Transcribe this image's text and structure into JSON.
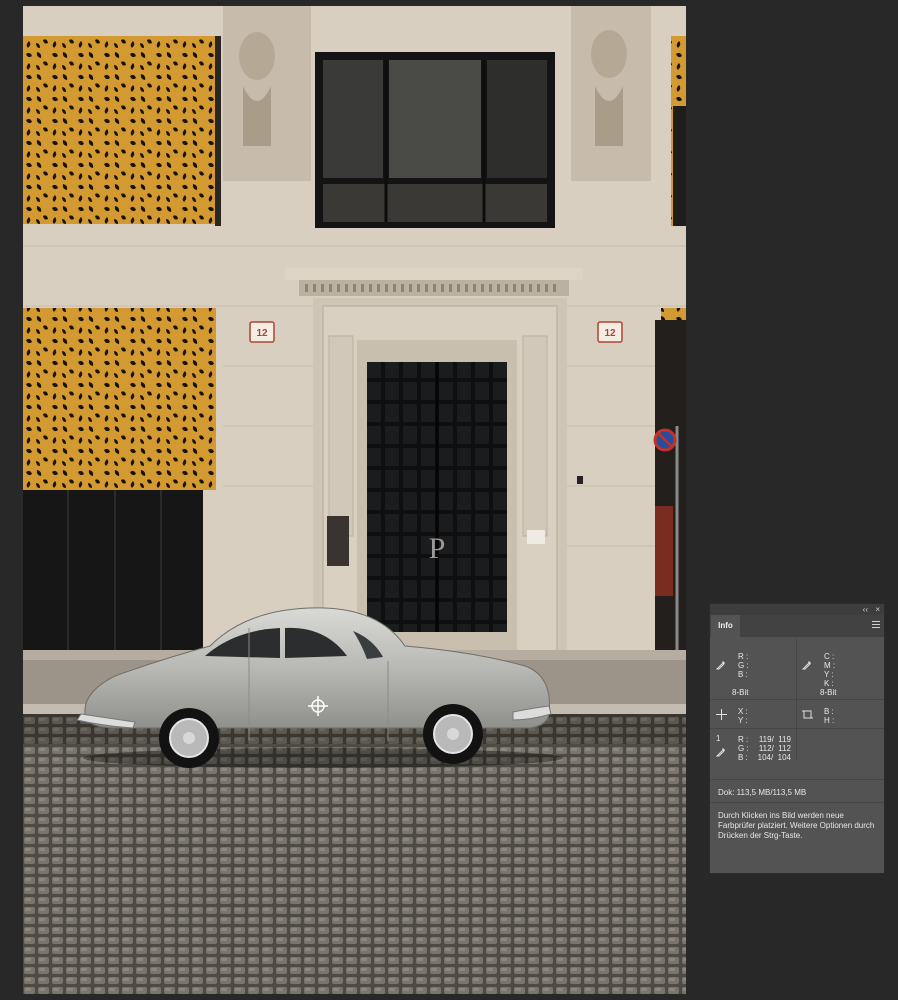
{
  "photo": {
    "house_number_left": "12",
    "house_number_right": "12",
    "door_monogram": "P"
  },
  "info_panel": {
    "controls": {
      "collapse": "‹‹",
      "close": "×"
    },
    "tab_label": "Info",
    "rgb": {
      "r_label": "R :",
      "g_label": "G :",
      "b_label": "B :",
      "bit_depth": "8-Bit"
    },
    "cmyk": {
      "c_label": "C :",
      "m_label": "M :",
      "y_label": "Y :",
      "k_label": "K :",
      "bit_depth": "8-Bit"
    },
    "position": {
      "x_label": "X :",
      "y_label": "Y :"
    },
    "size": {
      "b_label": "B :",
      "h_label": "H :"
    },
    "sampler": {
      "index": "1",
      "r_label": "R :",
      "r_value": "119/  119",
      "g_label": "G :",
      "g_value": "112/  112",
      "b_label": "B :",
      "b_value": "104/  104"
    },
    "document_size": "Dok: 113,5 MB/113,5 MB",
    "hint_text": "Durch Klicken ins Bild werden neue Farbprüfer platziert. Weitere Optionen durch Drücken der Strg-Taste."
  }
}
